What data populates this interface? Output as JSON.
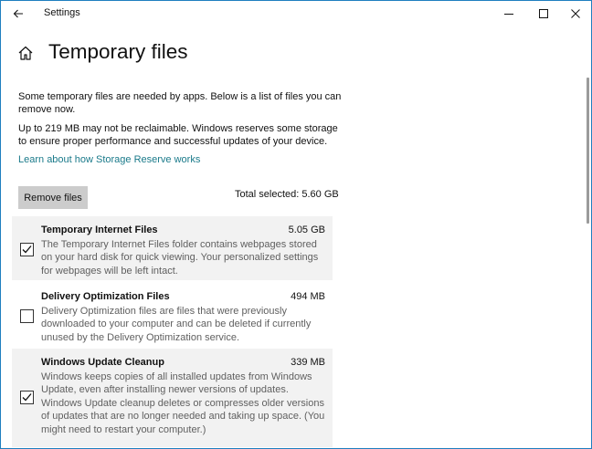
{
  "window": {
    "title": "Settings"
  },
  "page": {
    "title": "Temporary files"
  },
  "intro": {
    "text1": "Some temporary files are needed by apps. Below is a list of files you can remove now.",
    "text2": "Up to 219 MB may not be reclaimable. Windows reserves some storage to ensure proper performance and successful updates of your device.",
    "link": "Learn about how Storage Reserve works"
  },
  "actions": {
    "remove_label": "Remove files",
    "total_selected": "Total selected: 5.60 GB"
  },
  "items": [
    {
      "name": "Temporary Internet Files",
      "size": "5.05 GB",
      "checked": true,
      "description": "The Temporary Internet Files folder contains webpages stored on your hard disk for quick viewing. Your personalized settings for webpages will be left intact."
    },
    {
      "name": "Delivery Optimization Files",
      "size": "494 MB",
      "checked": false,
      "description": "Delivery Optimization files are files that were previously downloaded to your computer and can be deleted if currently unused by the Delivery Optimization service."
    },
    {
      "name": "Windows Update Cleanup",
      "size": "339 MB",
      "checked": true,
      "description": "Windows keeps copies of all installed updates from Windows Update, even after installing newer versions of updates. Windows Update cleanup deletes or compresses older versions of updates that are no longer needed and taking up space. (You might need to restart your computer.)"
    }
  ],
  "colors": {
    "link": "#1a7a8a",
    "window_border": "#1f7fbf",
    "selected_item_bg": "#f2f2f2",
    "button_bg": "#cccccc"
  }
}
